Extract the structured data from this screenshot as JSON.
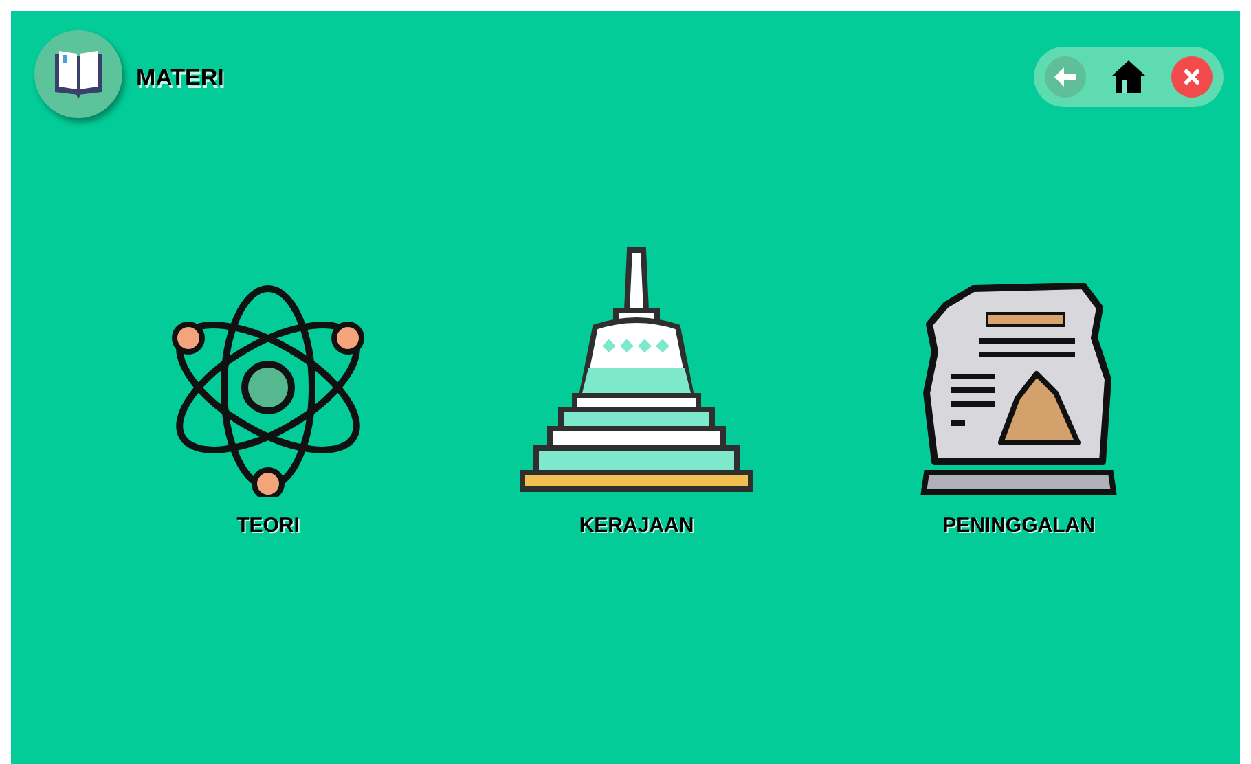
{
  "header": {
    "title": "MATERI"
  },
  "nav_buttons": [
    {
      "kind": "back"
    },
    {
      "kind": "home"
    },
    {
      "kind": "close"
    }
  ],
  "menu_items": [
    {
      "kind": "atom",
      "label": "TEORI"
    },
    {
      "kind": "stupa",
      "label": "KERAJAAN"
    },
    {
      "kind": "stone",
      "label": "PENINGGALAN"
    }
  ]
}
